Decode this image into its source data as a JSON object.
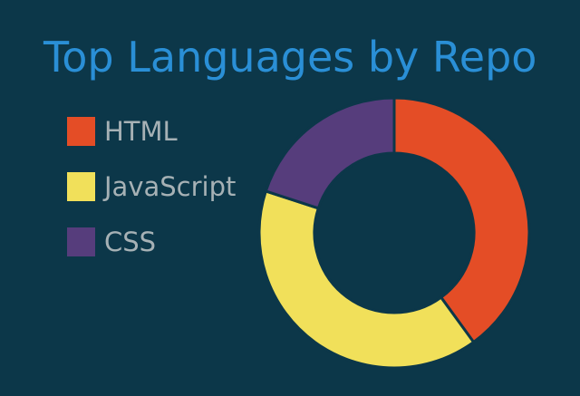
{
  "colors": {
    "background": "#0c3749",
    "title": "#2a8fd6",
    "legend_text": "#a6b1b5",
    "slice_gap": "#0c3749"
  },
  "chart_data": {
    "type": "pie",
    "variant": "donut",
    "title": "Top Languages by Repo",
    "legend_position": "left",
    "categories": [
      "HTML",
      "JavaScript",
      "CSS"
    ],
    "values": [
      40,
      40,
      20
    ],
    "colors": [
      "#e44d26",
      "#f1e05a",
      "#563d7c"
    ]
  }
}
